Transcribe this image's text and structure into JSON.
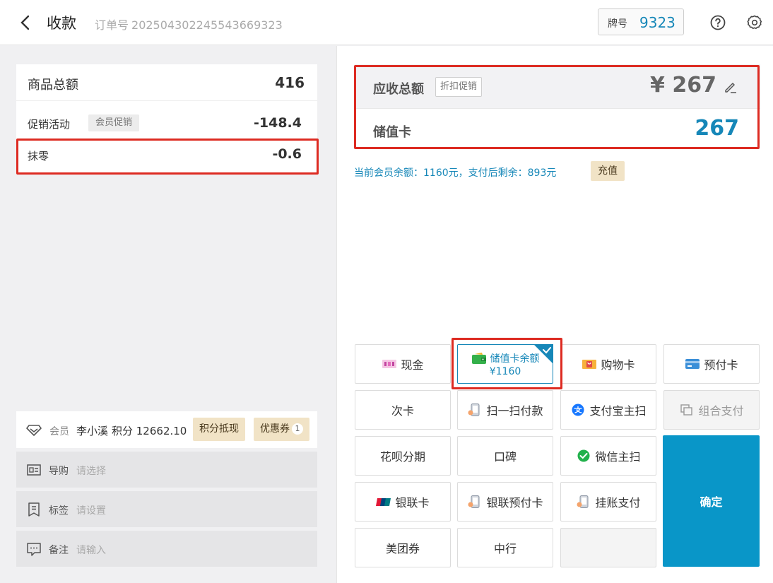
{
  "header": {
    "title": "收款",
    "order_label": "订单号",
    "order_no": "20250430224554366932​3",
    "tag_label": "牌号",
    "tag_value": "9323"
  },
  "summary": {
    "total_label": "商品总额",
    "total_value": "416",
    "promo_label": "促销活动",
    "promo_badge": "会员促销",
    "promo_value": "-148.4",
    "round_label": "抹零",
    "round_value": "-0.6"
  },
  "member": {
    "label": "会员",
    "name": "李小溪",
    "points_text": "积分 12662.10",
    "points_button": "积分抵现",
    "coupon_button": "优惠券",
    "coupon_count": "1"
  },
  "options": [
    {
      "label": "导购",
      "placeholder": "请选择"
    },
    {
      "label": "标签",
      "placeholder": "请设置"
    },
    {
      "label": "备注",
      "placeholder": "请输入"
    }
  ],
  "due": {
    "label": "应收总额",
    "badge": "折扣促销",
    "amount": "¥ 267",
    "card_label": "储值卡",
    "card_amount": "267"
  },
  "balance": {
    "text": "当前会员余额：1160元，支付后剩余：893元",
    "recharge": "充值"
  },
  "payments": {
    "cash": "现金",
    "stored_value": "储值卡余额",
    "stored_value_amount": "¥1160",
    "shopping_card": "购物卡",
    "prepaid_card": "预付卡",
    "times_card": "次卡",
    "scan_pay": "扫一扫付款",
    "alipay_scan": "支付宝主扫",
    "combo_pay": "组合支付",
    "huabei": "花呗分期",
    "koubei": "口碑",
    "wechat_scan": "微信主扫",
    "unionpay_card": "银联卡",
    "unionpay_prepaid": "银联预付卡",
    "credit_pay": "挂账支付",
    "meituan": "美团券",
    "bank": "中行",
    "confirm": "确定"
  },
  "colors": {
    "accent": "#1687b8",
    "confirm": "#0996c8",
    "highlight": "#dd2b22",
    "tag_bg": "#f1e3c6"
  }
}
